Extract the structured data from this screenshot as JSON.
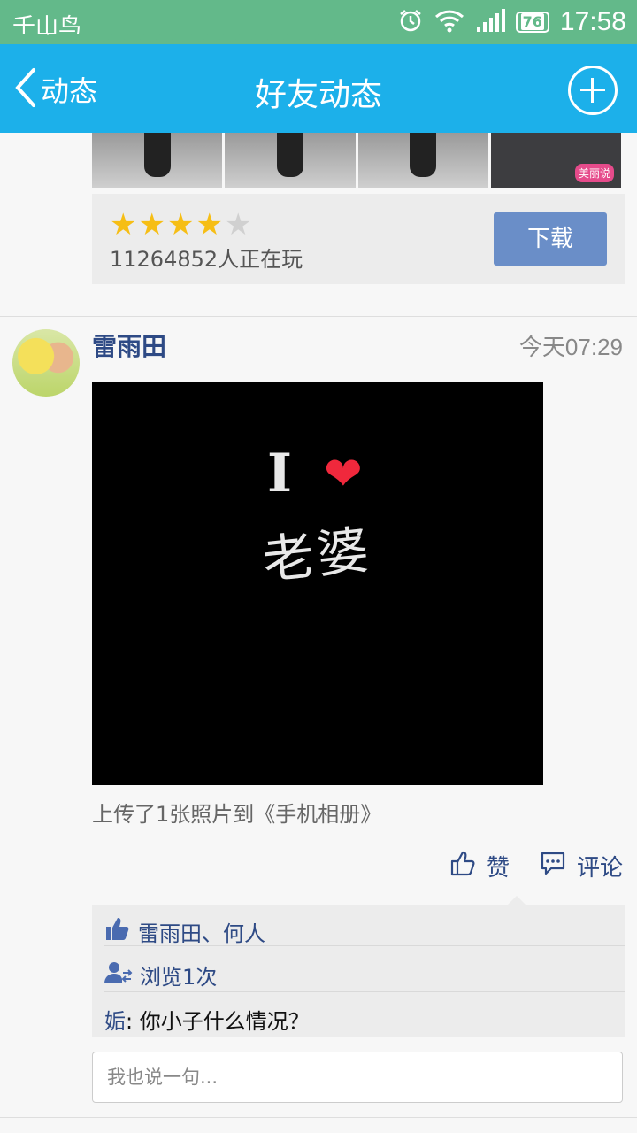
{
  "status_bar": {
    "carrier": "千山鸟",
    "battery": "76",
    "time": "17:58",
    "colors": {
      "bg": "#63b98a"
    }
  },
  "nav": {
    "back_label": "动态",
    "title": "好友动态",
    "colors": {
      "bg": "#1cb0ea"
    }
  },
  "game_card": {
    "thumb_badge": "美丽说",
    "rating": 4,
    "rating_max": 5,
    "players": "11264852人正在玩",
    "download_label": "下载"
  },
  "post": {
    "author": "雷雨田",
    "time": "今天07:29",
    "caption": "上传了1张照片到《手机相册》",
    "like_label": "赞",
    "comment_label": "评论",
    "likes": "雷雨田、何人",
    "views": "浏览1次",
    "comment": {
      "author": "姤",
      "text": ": 你小子什么情况？"
    },
    "input_placeholder": "我也说一句..."
  }
}
